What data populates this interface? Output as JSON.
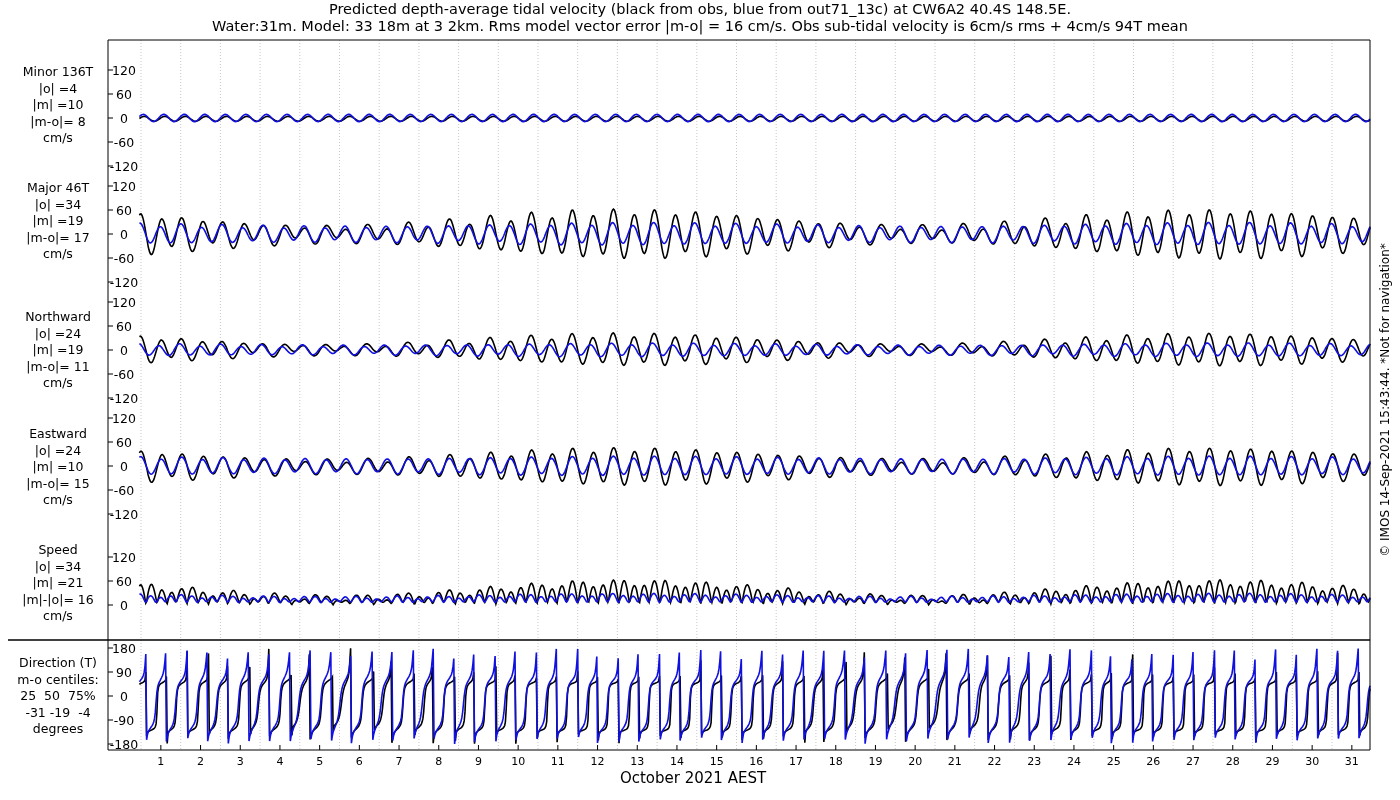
{
  "title": [
    "Predicted depth-average tidal velocity (black from obs, blue from out71_13c) at CW6A2 40.4S 148.5E.",
    "Water:31m. Model: 33 18m at 3 2km. Rms model vector error |m-o| = 16 cm/s. Obs sub-tidal velocity is 6cm/s rms + 4cm/s 94T mean"
  ],
  "panels": [
    {
      "kind": "minor",
      "labels": [
        "Minor 136T",
        "|o| =4",
        "|m| =10",
        "|m-o|= 8",
        "cm/s"
      ],
      "yticks": [
        "120",
        "60",
        "0",
        "-60",
        "-120"
      ]
    },
    {
      "kind": "major",
      "labels": [
        "Major 46T",
        "|o| =34",
        "|m| =19",
        "|m-o|= 17",
        "cm/s"
      ],
      "yticks": [
        "120",
        "60",
        "0",
        "-60",
        "-120"
      ]
    },
    {
      "kind": "north",
      "labels": [
        "Northward",
        "|o| =24",
        "|m| =19",
        "|m-o|= 11",
        "cm/s"
      ],
      "yticks": [
        "120",
        "60",
        "0",
        "-60",
        "-120"
      ]
    },
    {
      "kind": "east",
      "labels": [
        "Eastward",
        "|o| =24",
        "|m| =10",
        "|m-o|= 15",
        "cm/s"
      ],
      "yticks": [
        "120",
        "60",
        "0",
        "-60",
        "-120"
      ]
    },
    {
      "kind": "speed",
      "labels": [
        "Speed",
        "|o| =34",
        "|m| =21",
        "|m|-|o|= 16",
        "cm/s"
      ],
      "yticks": [
        "120",
        "60",
        "0"
      ]
    },
    {
      "kind": "direction",
      "labels": [
        "Direction (T)",
        "m-o centiles:",
        "25  50  75%",
        "-31 -19  -4",
        "degrees"
      ],
      "yticks": [
        "180",
        "90",
        "0",
        "-90",
        "-180"
      ]
    }
  ],
  "xticks": [
    "1",
    "2",
    "3",
    "4",
    "5",
    "6",
    "7",
    "8",
    "9",
    "10",
    "11",
    "12",
    "13",
    "14",
    "15",
    "16",
    "17",
    "18",
    "19",
    "20",
    "21",
    "22",
    "23",
    "24",
    "25",
    "26",
    "27",
    "28",
    "29",
    "30",
    "31"
  ],
  "xlabel": "October 2021 AEST",
  "side_note": "© IMOS 14-Sep-2021 15:43:44. *Not for navigation*"
}
